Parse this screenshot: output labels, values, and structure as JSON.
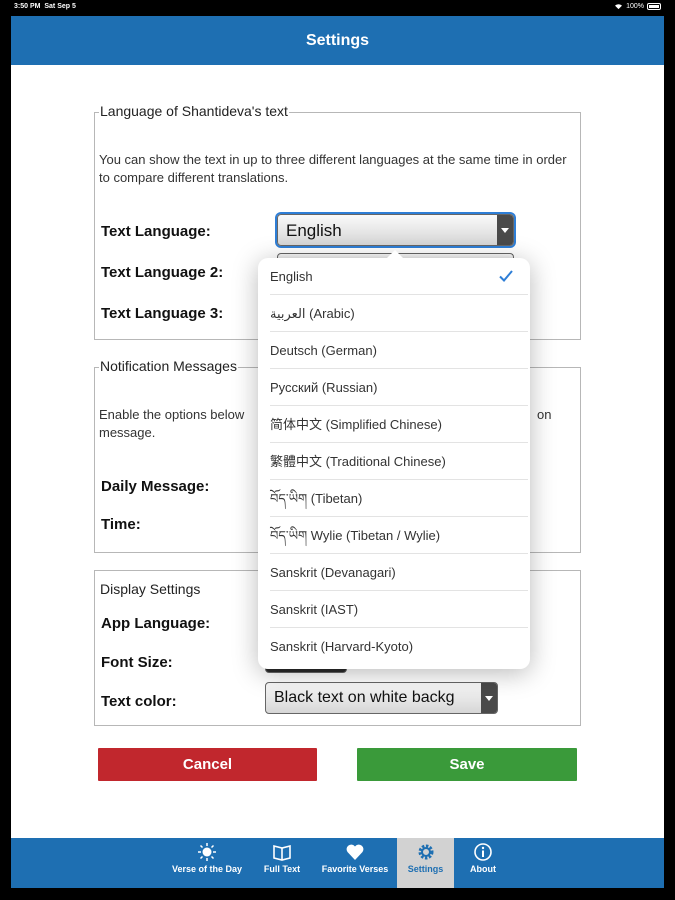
{
  "status_bar": {
    "time": "3:50 PM",
    "date": "Sat Sep 5",
    "battery": "100%"
  },
  "nav": {
    "title": "Settings"
  },
  "language_section": {
    "legend": "Language of Shantideva's text",
    "description": "You can show the text in up to three different languages at the same time in order to compare different translations.",
    "labels": [
      "Text Language:",
      "Text Language 2:",
      "Text Language 3:"
    ],
    "text_language_value": "English"
  },
  "notification_section": {
    "legend": "Notification Messages",
    "description_start": "Enable the options below",
    "description_end": "on",
    "description_line2": "message.",
    "labels": [
      "Daily Message:",
      "Time:"
    ]
  },
  "display_section": {
    "legend": "Display Settings",
    "labels": [
      "App Language:",
      "Font Size:",
      "Text color:"
    ],
    "text_color_value": "Black text on white backg"
  },
  "buttons": {
    "cancel": "Cancel",
    "save": "Save"
  },
  "dropdown": {
    "options": [
      "English",
      "العربية (Arabic)",
      "Deutsch (German)",
      "Русский (Russian)",
      "简体中文 (Simplified Chinese)",
      "繁體中文 (Traditional Chinese)",
      "བོད་ཡིག (Tibetan)",
      "བོད་ཡིག Wylie (Tibetan / Wylie)",
      "Sanskrit (Devanagari)",
      "Sanskrit (IAST)",
      "Sanskrit (Harvard-Kyoto)"
    ],
    "selected_index": 0
  },
  "tabs": [
    {
      "label": "Verse of the Day",
      "icon": "sun-icon"
    },
    {
      "label": "Full Text",
      "icon": "book-icon"
    },
    {
      "label": "Favorite Verses",
      "icon": "heart-icon"
    },
    {
      "label": "Settings",
      "icon": "gear-icon"
    },
    {
      "label": "About",
      "icon": "info-icon"
    }
  ],
  "colors": {
    "primary": "#1e6fb2",
    "cancel": "#c1272d",
    "save": "#3a9a3a",
    "check": "#2e7ed6"
  }
}
